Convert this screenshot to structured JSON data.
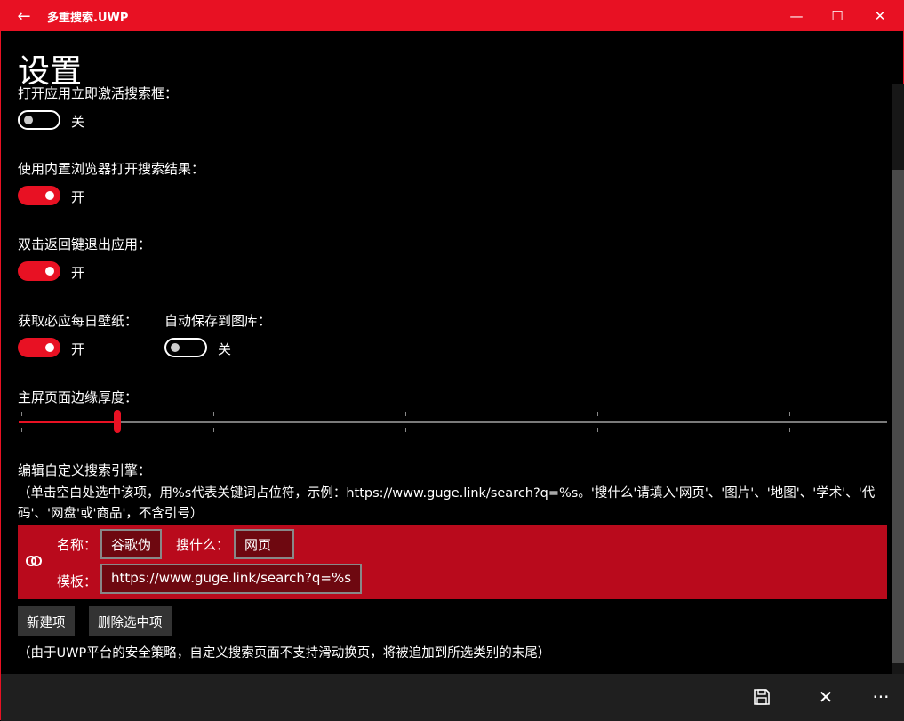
{
  "window": {
    "title": "多重搜索.UWP",
    "back": "←",
    "minimize": "—",
    "maximize": "☐",
    "close": "✕"
  },
  "page": {
    "title": "设置"
  },
  "settings": [
    {
      "label": "打开应用立即激活搜索框：",
      "state": "关",
      "on": false
    },
    {
      "label": "使用内置浏览器打开搜索结果：",
      "state": "开",
      "on": true
    },
    {
      "label": "双击返回键退出应用：",
      "state": "开",
      "on": true
    },
    {
      "label": "获取必应每日壁纸：",
      "state": "开",
      "on": true
    },
    {
      "label": "自动保存到图库：",
      "state": "关",
      "on": false
    }
  ],
  "border_thickness": {
    "label": "主屏页面边缘厚度：",
    "value_fraction": 0.114
  },
  "engines": {
    "label": "编辑自定义搜索引擎：",
    "hint": "（单击空白处选中该项，用%s代表关键词占位符，示例：https://www.guge.link/search?q=%s。'搜什么'请填入'网页'、'图片'、'地图'、'学术'、'代码'、'网盘'或'商品'，不含引号）",
    "item": {
      "name_label": "名称：",
      "name": "谷歌伪",
      "type_label": "搜什么：",
      "type": "网页",
      "template_label": "模板：",
      "template": "https://www.guge.link/search?q=%s",
      "icon": "link-icon"
    },
    "new_button": "新建项",
    "delete_button": "删除选中项",
    "note": "（由于UWP平台的安全策略，自定义搜索页面不支持滑动换页，将被追加到所选类别的末尾）"
  },
  "commands": {
    "save": "save-icon",
    "cancel": "✕",
    "more": "···"
  },
  "colors": {
    "accent": "#e81123",
    "card": "#b90a1c"
  }
}
